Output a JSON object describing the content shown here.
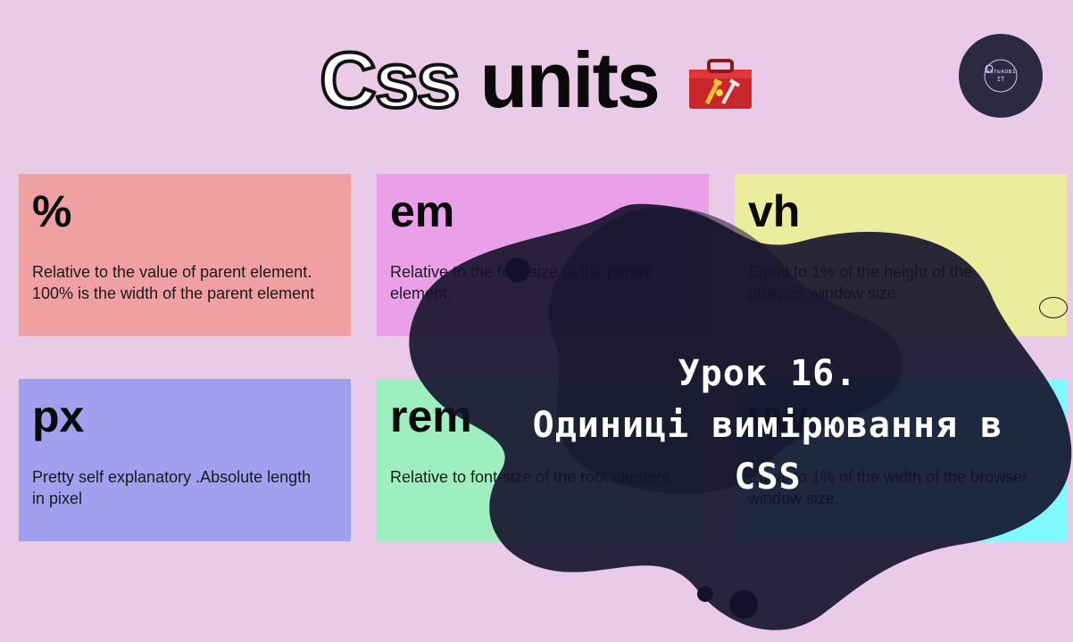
{
  "colors": {
    "background": "#e9cbe8",
    "card_percent": "#f0a0a2",
    "card_em": "#e9a0e9",
    "card_vh": "#ecec9e",
    "card_px": "#a0a0ef",
    "card_rem": "#9eeec0",
    "card_vw": "#7efaff",
    "blob": "#14122a"
  },
  "header": {
    "title_outline": "Css",
    "title_solid": "units",
    "toolbox_icon": "toolbox-icon"
  },
  "logo": {
    "line1": "Батькові",
    "line2": "IT"
  },
  "cards": [
    {
      "unit": "%",
      "desc": "Relative to the value of parent element. 100% is the width of the parent element"
    },
    {
      "unit": "em",
      "desc": "Relative to the font-size of the parent element."
    },
    {
      "unit": "vh",
      "desc": "Equal to 1% of the height of the browser window size."
    },
    {
      "unit": "px",
      "desc": "Pretty self explanatory .Absolute length in pixel"
    },
    {
      "unit": "rem",
      "desc": "Relative to font-size of the root element."
    },
    {
      "unit": "vw",
      "desc": "Equal to 1% of the width of the browser window size."
    }
  ],
  "overlay": {
    "lesson_line1": "Урок 16.",
    "lesson_line2": "Одиниці вимірювання в CSS"
  }
}
